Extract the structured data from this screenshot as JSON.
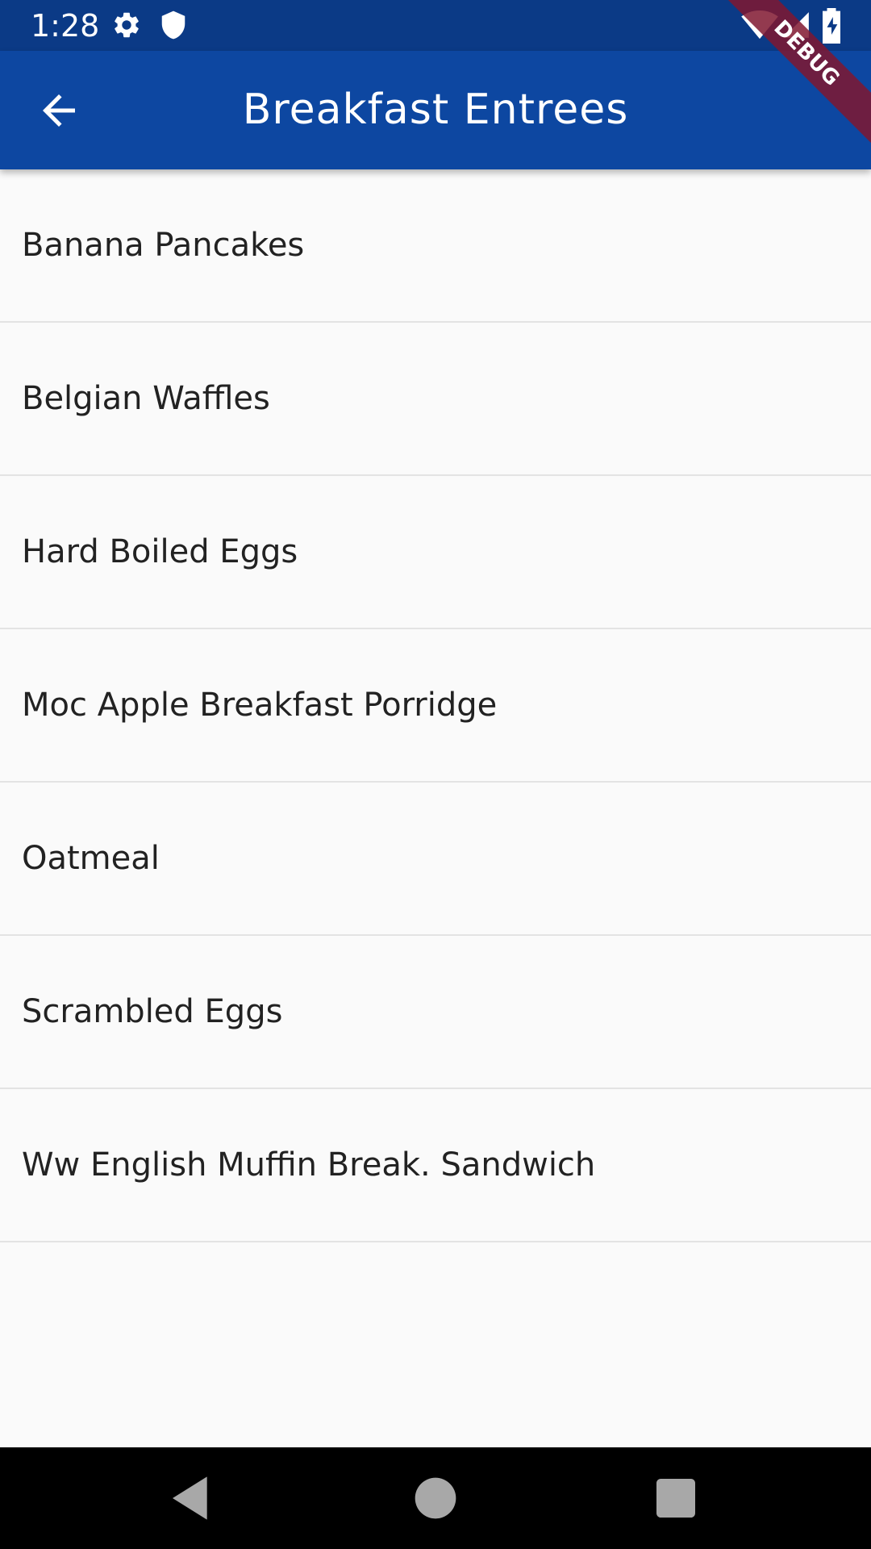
{
  "status_bar": {
    "time": "1:28",
    "icons": [
      "gear-icon",
      "shield-icon",
      "wifi-icon",
      "cell-signal-icon",
      "battery-charging-icon"
    ]
  },
  "debug_banner": {
    "label": "DEBUG"
  },
  "app_bar": {
    "title": "Breakfast Entrees",
    "back_icon": "arrow-left-icon"
  },
  "entrees": [
    {
      "label": "Banana Pancakes"
    },
    {
      "label": "Belgian Waffles"
    },
    {
      "label": "Hard Boiled Eggs"
    },
    {
      "label": "Moc Apple Breakfast Porridge"
    },
    {
      "label": "Oatmeal"
    },
    {
      "label": "Scrambled Eggs"
    },
    {
      "label": "Ww English Muffin Break. Sandwich"
    }
  ],
  "nav_bar": {
    "icons": [
      "nav-back-triangle-icon",
      "nav-home-circle-icon",
      "nav-recents-square-icon"
    ]
  },
  "colors": {
    "status_bar": "#0b3a86",
    "app_bar": "#0d47a1",
    "background": "#fafafa",
    "divider": "#e3e3e3",
    "debug_ribbon": "#801830"
  }
}
